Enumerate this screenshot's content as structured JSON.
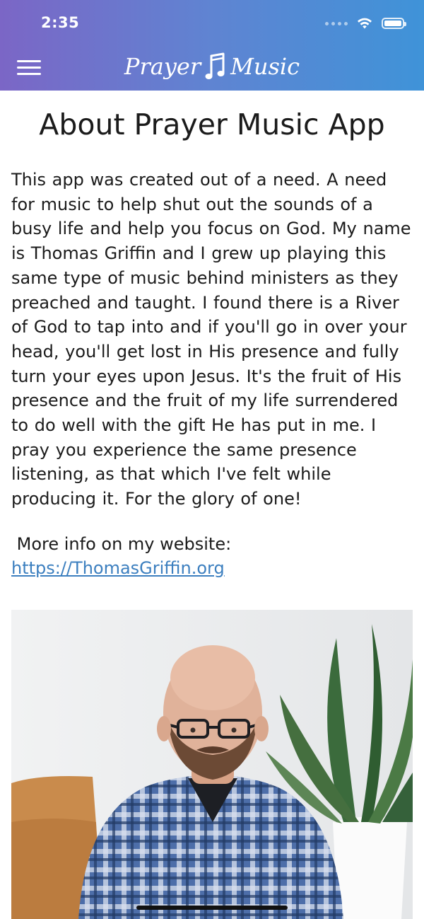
{
  "status_bar": {
    "time": "2:35",
    "icons": [
      "cellular-dots-icon",
      "wifi-icon",
      "battery-icon"
    ]
  },
  "header": {
    "menu_icon": "hamburger-menu-icon",
    "brand_word_1": "Prayer",
    "brand_word_2": "Music",
    "brand_icon": "music-note-icon",
    "gradient": [
      "#7b66c6",
      "#5f84d2",
      "#3f93d8"
    ]
  },
  "page": {
    "title": "About Prayer Music App",
    "body": "This app was created out of a need. A need for music to help shut out the sounds of a busy life and help you focus on God.  My name is Thomas Griffin and I grew up playing this same type of music behind ministers as they preached and taught. I found there is a River of God to tap into and if you'll go in over your head, you'll get lost in His presence and fully turn your eyes upon Jesus. It's the fruit of His presence and the fruit of my life surrendered to do well with the gift He has put in me. I pray you experience the same presence listening, as that which I've felt while producing it. For the glory of one!",
    "more_info_label": " More info on my website:",
    "website_url": "https://ThomasGriffin.org",
    "photo_subject": "portrait-photo"
  },
  "colors": {
    "link": "#3c7fbf",
    "text": "#1b1b1b"
  }
}
